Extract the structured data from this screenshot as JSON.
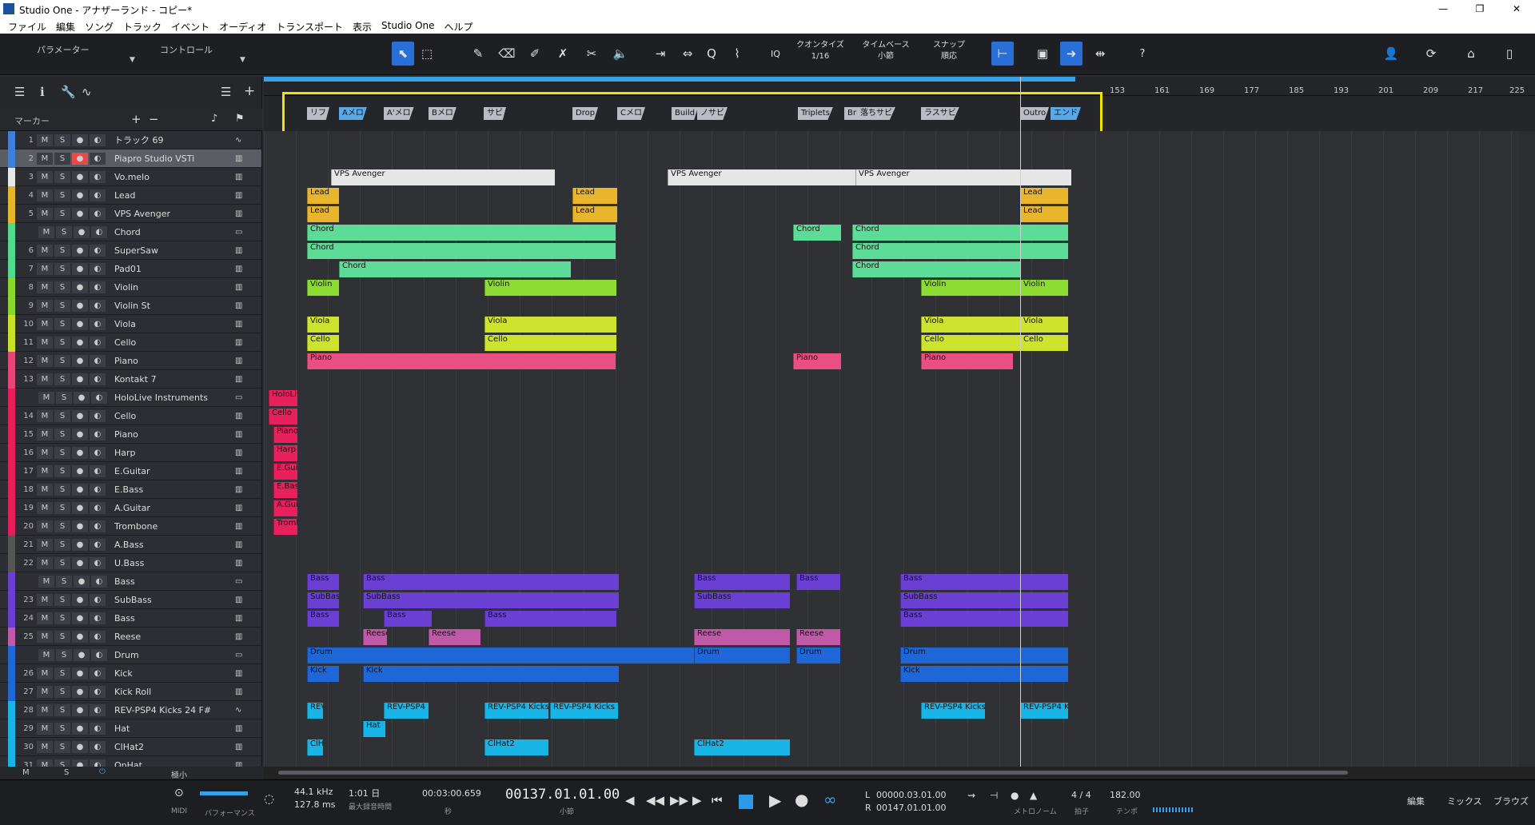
{
  "window": {
    "title": "Studio One - アナザーランド - コピー*"
  },
  "menu": [
    "ファイル",
    "編集",
    "ソング",
    "トラック",
    "イベント",
    "オーディオ",
    "トランスポート",
    "表示",
    "Studio One",
    "ヘルプ"
  ],
  "toolbar": {
    "params_label": "パラメーター",
    "control_label": "コントロール",
    "quantize_label": "クオンタイズ",
    "quantize_value": "1/16",
    "timebase_label": "タイムベース",
    "timebase_value": "小節",
    "snap_label": "スナップ",
    "snap_value": "順応",
    "iq_label": "IQ",
    "help_label": "?"
  },
  "ruler": {
    "numbers": [
      "153",
      "161",
      "169",
      "177",
      "185",
      "193",
      "201",
      "209",
      "217",
      "225"
    ]
  },
  "markers_label": "マーカー",
  "markers": [
    {
      "label": "リフ",
      "hl": false
    },
    {
      "label": "Aメロ",
      "hl": true
    },
    {
      "label": "A'メロ",
      "hl": false
    },
    {
      "label": "Bメロ",
      "hl": false
    },
    {
      "label": "サビ",
      "hl": false
    },
    {
      "label": "Drop",
      "hl": false
    },
    {
      "label": "Cメロ",
      "hl": false
    },
    {
      "label": "Build",
      "hl": false
    },
    {
      "label": "ノサビ",
      "hl": false
    },
    {
      "label": "Triplets",
      "hl": false
    },
    {
      "label": "Bri",
      "hl": false
    },
    {
      "label": "落ちサビ",
      "hl": false
    },
    {
      "label": "ラスサビ",
      "hl": false
    },
    {
      "label": "Outro",
      "hl": false
    },
    {
      "label": "エンド",
      "hl": true
    }
  ],
  "tracks": [
    {
      "num": "1",
      "name": "トラック 69",
      "color": "#3f7fd8",
      "icon": "wave"
    },
    {
      "num": "2",
      "name": "Piapro Studio VSTi",
      "color": "#3f7fd8",
      "icon": "midi",
      "selected": true
    },
    {
      "num": "3",
      "name": "Vo.melo",
      "color": "#e8e8e8",
      "icon": "midi"
    },
    {
      "num": "4",
      "name": "Lead",
      "color": "#e5b52a",
      "icon": "midi"
    },
    {
      "num": "5",
      "name": "VPS Avenger",
      "color": "#e5b52a",
      "icon": "midi"
    },
    {
      "num": "",
      "name": "Chord",
      "color": "#52d98c",
      "icon": "folder"
    },
    {
      "num": "6",
      "name": "SuperSaw",
      "color": "#52d98c",
      "icon": "midi"
    },
    {
      "num": "7",
      "name": "Pad01",
      "color": "#52d98c",
      "icon": "midi"
    },
    {
      "num": "8",
      "name": "Violin",
      "color": "#8ad82f",
      "icon": "midi"
    },
    {
      "num": "9",
      "name": "Violin St",
      "color": "#8ad82f",
      "icon": "midi"
    },
    {
      "num": "10",
      "name": "Viola",
      "color": "#c7e02a",
      "icon": "midi"
    },
    {
      "num": "11",
      "name": "Cello",
      "color": "#c7e02a",
      "icon": "midi"
    },
    {
      "num": "12",
      "name": "Piano",
      "color": "#e8467a",
      "icon": "midi"
    },
    {
      "num": "13",
      "name": "Kontakt 7",
      "color": "#e8467a",
      "icon": "midi"
    },
    {
      "num": "",
      "name": "HoloLive Instruments",
      "color": "#e81e5a",
      "icon": "folder"
    },
    {
      "num": "14",
      "name": "Cello",
      "color": "#e81e5a",
      "icon": "midi"
    },
    {
      "num": "15",
      "name": "Piano",
      "color": "#e81e5a",
      "icon": "midi"
    },
    {
      "num": "16",
      "name": "Harp",
      "color": "#e81e5a",
      "icon": "midi"
    },
    {
      "num": "17",
      "name": "E.Guitar",
      "color": "#e81e5a",
      "icon": "midi"
    },
    {
      "num": "18",
      "name": "E.Bass",
      "color": "#e81e5a",
      "icon": "midi"
    },
    {
      "num": "19",
      "name": "A.Guitar",
      "color": "#e81e5a",
      "icon": "midi"
    },
    {
      "num": "20",
      "name": "Trombone",
      "color": "#e81e5a",
      "icon": "midi"
    },
    {
      "num": "21",
      "name": "A.Bass",
      "color": "#555",
      "icon": "midi"
    },
    {
      "num": "22",
      "name": "U.Bass",
      "color": "#555",
      "icon": "midi"
    },
    {
      "num": "",
      "name": "Bass",
      "color": "#6a3fd0",
      "icon": "folder"
    },
    {
      "num": "23",
      "name": "SubBass",
      "color": "#6a3fd0",
      "icon": "midi"
    },
    {
      "num": "24",
      "name": "Bass",
      "color": "#6a3fd0",
      "icon": "midi"
    },
    {
      "num": "25",
      "name": "Reese",
      "color": "#c05aa8",
      "icon": "midi"
    },
    {
      "num": "",
      "name": "Drum",
      "color": "#1f66d6",
      "icon": "folder"
    },
    {
      "num": "26",
      "name": "Kick",
      "color": "#1f66d6",
      "icon": "midi"
    },
    {
      "num": "27",
      "name": "Kick Roll",
      "color": "#1f66d6",
      "icon": "midi"
    },
    {
      "num": "28",
      "name": "REV-PSP4 Kicks 24 F#",
      "color": "#18b4e6",
      "icon": "wave"
    },
    {
      "num": "29",
      "name": "Hat",
      "color": "#18b4e6",
      "icon": "midi"
    },
    {
      "num": "30",
      "name": "ClHat2",
      "color": "#18b4e6",
      "icon": "midi"
    },
    {
      "num": "31",
      "name": "OpHat",
      "color": "#18b4e6",
      "icon": "midi"
    }
  ],
  "bottom_left": {
    "m": "M",
    "s": "S",
    "size": "極小"
  },
  "transport": {
    "midi_label": "MIDI",
    "perf_label": "パフォーマンス",
    "sample_rate": "44.1 kHz",
    "latency": "127.8 ms",
    "rec_days": "1:01 日",
    "rec_label": "最大録音時間",
    "time_sec": "00:03:00.659",
    "sec_label": "秒",
    "position": "00137.01.01.00",
    "pos_label": "小節",
    "loop_l_label": "L",
    "loop_l": "00000.03.01.00",
    "loop_r_label": "R",
    "loop_r": "00147.01.01.00",
    "metronome_label": "メトロノーム",
    "signature": "4 / 4",
    "sig_label": "拍子",
    "tempo": "182.00",
    "tempo_label": "テンポ",
    "edit": "編集",
    "mix": "ミックス",
    "browse": "ブラウズ"
  }
}
